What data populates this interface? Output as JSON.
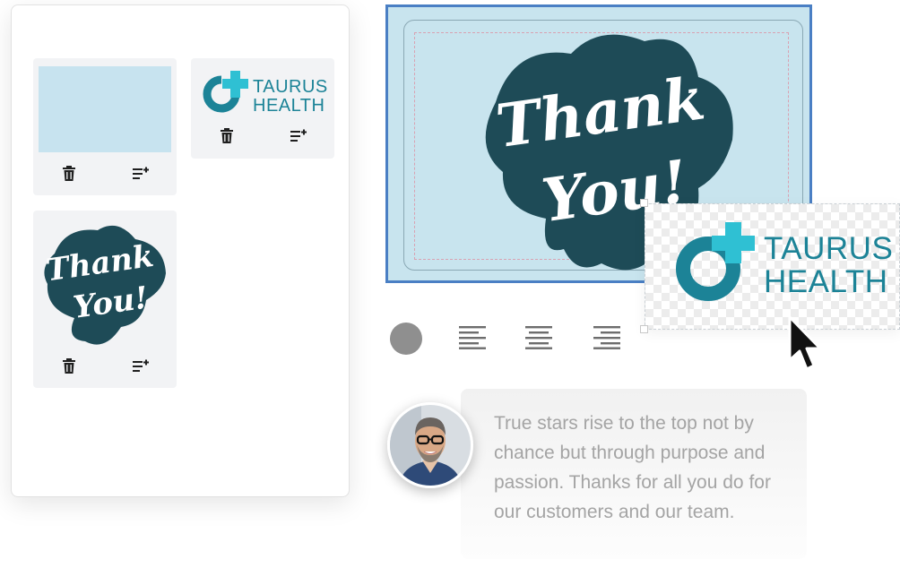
{
  "asset_panel": {
    "logo_line1": "TAURUS",
    "logo_line2": "HEALTH",
    "card_icons": [
      "trash-icon",
      "add-to-list-icon"
    ]
  },
  "canvas": {
    "artwork_line1": "Thank",
    "artwork_line2": "You!",
    "background_color": "#c8e4ee",
    "artwork_color": "#1e4b57"
  },
  "selected_logo": {
    "line1": "TAURUS",
    "line2": "HEALTH",
    "brand_color": "#1c8397",
    "accent_color": "#2fc0d3"
  },
  "toolbar": {
    "color_swatch": "#8f8f8f",
    "icons": [
      "align-left-icon",
      "align-center-icon",
      "align-right-icon"
    ]
  },
  "message": {
    "text": "True stars rise to the top not by chance but through purpose and passion. Thanks for all you do for our customers and our team."
  },
  "colors": {
    "selection_border": "#4a7fc4"
  }
}
